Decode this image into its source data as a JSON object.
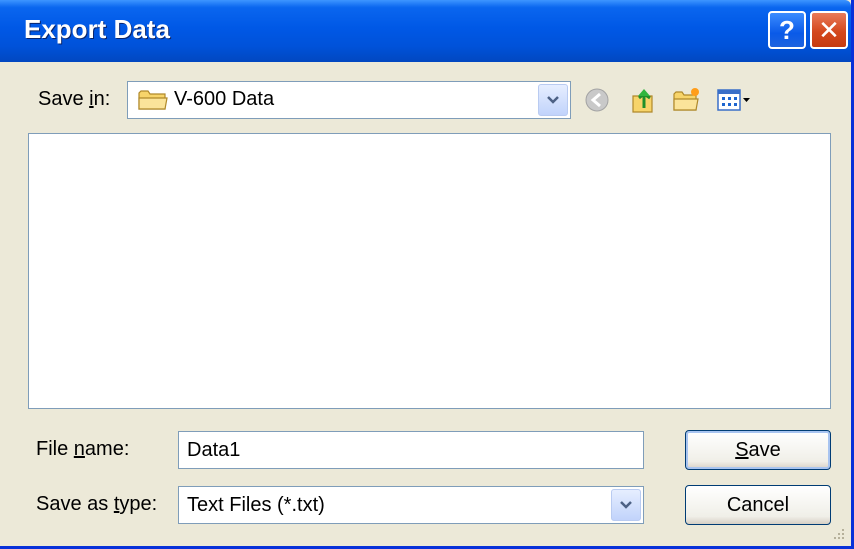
{
  "title": "Export Data",
  "titlebar_buttons": {
    "help": "?",
    "close": "✕"
  },
  "save_in": {
    "label_pre": "Save ",
    "label_accel": "i",
    "label_post": "n:",
    "value": "V-600 Data"
  },
  "file_name": {
    "label_pre": "File ",
    "label_accel": "n",
    "label_post": "ame:",
    "value": "Data1"
  },
  "save_as_type": {
    "label_pre": "Save as ",
    "label_accel": "t",
    "label_post": "ype:",
    "value": "Text Files (*.txt)"
  },
  "buttons": {
    "save_accel": "S",
    "save_rest": "ave",
    "cancel": "Cancel"
  },
  "icons": [
    "folder-icon",
    "back-icon",
    "up-folder-icon",
    "new-folder-icon",
    "views-menu-icon",
    "chevron-down-icon"
  ],
  "colors": {
    "titlebar": "#0058e6",
    "window_bg": "#ece9d8",
    "close": "#d4481d",
    "field_border": "#7f9db9"
  }
}
